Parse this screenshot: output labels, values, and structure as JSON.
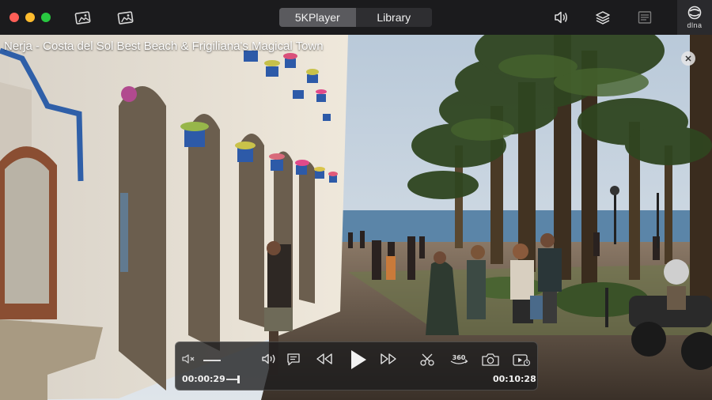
{
  "titlebar": {
    "tabs": [
      {
        "label": "5KPlayer",
        "active": true
      },
      {
        "label": "Library",
        "active": false
      }
    ],
    "dlna_label": "dlna"
  },
  "video": {
    "title": "Nerja - Costa del Sol Best Beach & Frigiliana's Magical Town"
  },
  "controls": {
    "current_time": "00:00:29",
    "total_time": "00:10:28",
    "volume_level": 0.5,
    "progress": 0.046
  },
  "icons": {
    "left_toolbar": [
      "photo-icon",
      "photo-alt-icon"
    ],
    "right_toolbar": [
      "airplay-audio-icon",
      "layers-icon",
      "playlist-icon",
      "dlna-icon"
    ],
    "control_bar": [
      "mute-icon",
      "volume-icon",
      "subtitle-icon",
      "rewind-icon",
      "play-icon",
      "fast-forward-icon",
      "cut-icon",
      "rotate-360-icon",
      "snapshot-icon",
      "record-icon"
    ]
  },
  "colors": {
    "titlebar_bg": "#1b1b1d",
    "close_red": "#ff5f57",
    "minimize_yellow": "#febc2e",
    "zoom_green": "#28c840"
  }
}
